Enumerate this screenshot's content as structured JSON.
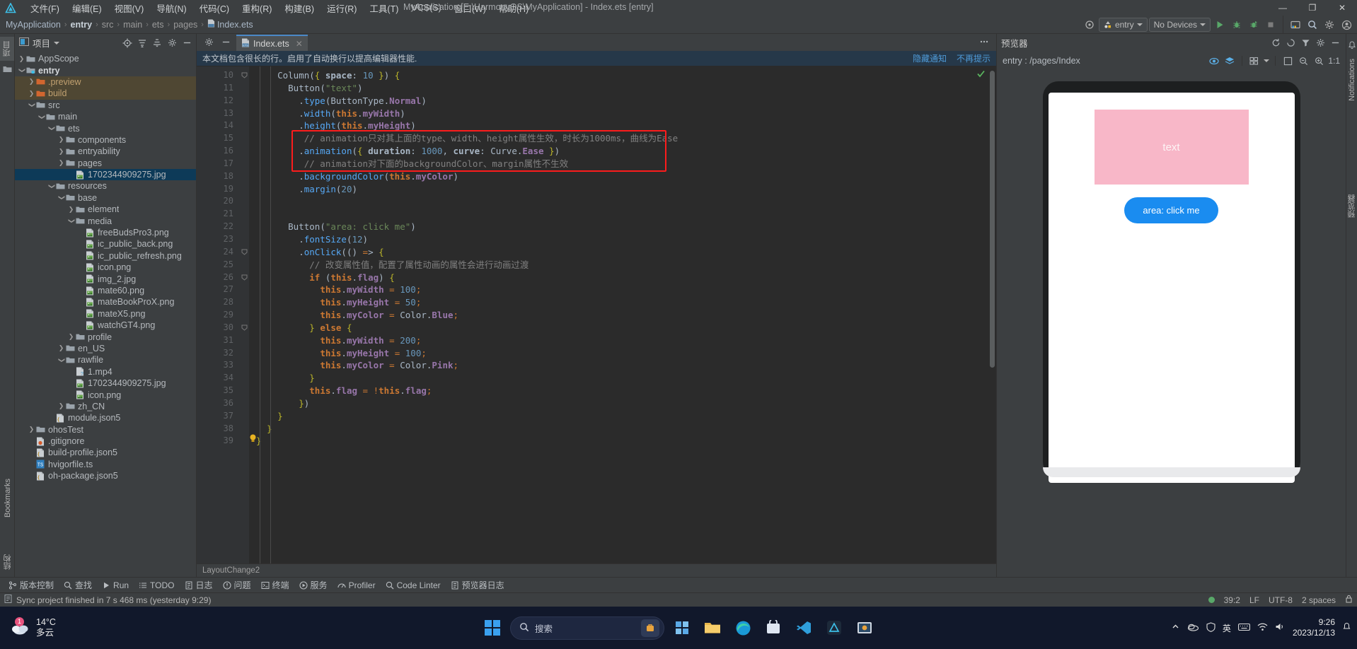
{
  "window": {
    "title": "MyApplication [E:\\HarmonyOS\\MyApplication] - Index.ets [entry]",
    "minimize": "—",
    "maximize": "❐",
    "close": "✕"
  },
  "menubar": {
    "items": [
      {
        "label": "文件(F)",
        "name": "menu-file"
      },
      {
        "label": "编辑(E)",
        "name": "menu-edit"
      },
      {
        "label": "视图(V)",
        "name": "menu-view"
      },
      {
        "label": "导航(N)",
        "name": "menu-navigate"
      },
      {
        "label": "代码(C)",
        "name": "menu-code"
      },
      {
        "label": "重构(R)",
        "name": "menu-refactor"
      },
      {
        "label": "构建(B)",
        "name": "menu-build"
      },
      {
        "label": "运行(R)",
        "name": "menu-run"
      },
      {
        "label": "工具(T)",
        "name": "menu-tools"
      },
      {
        "label": "VCS(S)",
        "name": "menu-vcs"
      },
      {
        "label": "窗口(W)",
        "name": "menu-window"
      },
      {
        "label": "帮助(H)",
        "name": "menu-help"
      }
    ]
  },
  "breadcrumb": {
    "items": [
      "MyApplication",
      "entry",
      "src",
      "main",
      "ets",
      "pages",
      "Index.ets"
    ],
    "separator": "›"
  },
  "toolbar": {
    "run_config": "entry",
    "device": "No Devices",
    "run_tooltip": "Run",
    "debug_tooltip": "Debug",
    "profile_tooltip": "Profile",
    "stop_tooltip": "Stop"
  },
  "sidebar_strip": {
    "project_tab": "项目",
    "bookmarks_tab": "Bookmarks",
    "structure_tab": "结构"
  },
  "project_panel": {
    "title": "项目",
    "tree": [
      {
        "label": "AppScope",
        "depth": 1,
        "type": "folder",
        "arrow": "collapsed",
        "state": "normal"
      },
      {
        "label": "entry",
        "depth": 1,
        "type": "module",
        "arrow": "expanded",
        "state": "bold"
      },
      {
        "label": ".preview",
        "depth": 2,
        "type": "folder-excluded",
        "arrow": "collapsed",
        "state": "highlight"
      },
      {
        "label": "build",
        "depth": 2,
        "type": "folder-excluded",
        "arrow": "collapsed",
        "state": "highlight"
      },
      {
        "label": "src",
        "depth": 2,
        "type": "folder",
        "arrow": "expanded",
        "state": "normal"
      },
      {
        "label": "main",
        "depth": 3,
        "type": "folder",
        "arrow": "expanded",
        "state": "normal"
      },
      {
        "label": "ets",
        "depth": 4,
        "type": "folder",
        "arrow": "expanded",
        "state": "normal"
      },
      {
        "label": "components",
        "depth": 5,
        "type": "folder",
        "arrow": "collapsed",
        "state": "normal"
      },
      {
        "label": "entryability",
        "depth": 5,
        "type": "folder",
        "arrow": "collapsed",
        "state": "normal"
      },
      {
        "label": "pages",
        "depth": 5,
        "type": "folder",
        "arrow": "collapsed",
        "state": "normal"
      },
      {
        "label": "1702344909275.jpg",
        "depth": 6,
        "type": "image",
        "arrow": "none",
        "state": "selected"
      },
      {
        "label": "resources",
        "depth": 4,
        "type": "folder",
        "arrow": "expanded",
        "state": "normal"
      },
      {
        "label": "base",
        "depth": 5,
        "type": "folder",
        "arrow": "expanded",
        "state": "normal"
      },
      {
        "label": "element",
        "depth": 6,
        "type": "folder",
        "arrow": "collapsed",
        "state": "normal"
      },
      {
        "label": "media",
        "depth": 6,
        "type": "folder",
        "arrow": "expanded",
        "state": "normal"
      },
      {
        "label": "freeBudsPro3.png",
        "depth": 7,
        "type": "image",
        "arrow": "none",
        "state": "normal"
      },
      {
        "label": "ic_public_back.png",
        "depth": 7,
        "type": "image",
        "arrow": "none",
        "state": "normal"
      },
      {
        "label": "ic_public_refresh.png",
        "depth": 7,
        "type": "image",
        "arrow": "none",
        "state": "normal"
      },
      {
        "label": "icon.png",
        "depth": 7,
        "type": "image",
        "arrow": "none",
        "state": "normal"
      },
      {
        "label": "img_2.jpg",
        "depth": 7,
        "type": "image",
        "arrow": "none",
        "state": "normal"
      },
      {
        "label": "mate60.png",
        "depth": 7,
        "type": "image",
        "arrow": "none",
        "state": "normal"
      },
      {
        "label": "mateBookProX.png",
        "depth": 7,
        "type": "image",
        "arrow": "none",
        "state": "normal"
      },
      {
        "label": "mateX5.png",
        "depth": 7,
        "type": "image",
        "arrow": "none",
        "state": "normal"
      },
      {
        "label": "watchGT4.png",
        "depth": 7,
        "type": "image",
        "arrow": "none",
        "state": "normal"
      },
      {
        "label": "profile",
        "depth": 6,
        "type": "folder",
        "arrow": "collapsed",
        "state": "normal"
      },
      {
        "label": "en_US",
        "depth": 5,
        "type": "folder",
        "arrow": "collapsed",
        "state": "normal"
      },
      {
        "label": "rawfile",
        "depth": 5,
        "type": "folder",
        "arrow": "expanded",
        "state": "normal"
      },
      {
        "label": "1.mp4",
        "depth": 6,
        "type": "video",
        "arrow": "none",
        "state": "normal"
      },
      {
        "label": "1702344909275.jpg",
        "depth": 6,
        "type": "image",
        "arrow": "none",
        "state": "normal"
      },
      {
        "label": "icon.png",
        "depth": 6,
        "type": "image",
        "arrow": "none",
        "state": "normal"
      },
      {
        "label": "zh_CN",
        "depth": 5,
        "type": "folder",
        "arrow": "collapsed",
        "state": "normal"
      },
      {
        "label": "module.json5",
        "depth": 4,
        "type": "json",
        "arrow": "none",
        "state": "normal"
      },
      {
        "label": "ohosTest",
        "depth": 2,
        "type": "folder",
        "arrow": "collapsed",
        "state": "normal"
      },
      {
        "label": ".gitignore",
        "depth": 2,
        "type": "gitignore",
        "arrow": "none",
        "state": "normal"
      },
      {
        "label": "build-profile.json5",
        "depth": 2,
        "type": "json",
        "arrow": "none",
        "state": "normal"
      },
      {
        "label": "hvigorfile.ts",
        "depth": 2,
        "type": "ts",
        "arrow": "none",
        "state": "normal"
      },
      {
        "label": "oh-package.json5",
        "depth": 2,
        "type": "json",
        "arrow": "none",
        "state": "normal"
      }
    ]
  },
  "editor": {
    "tab": {
      "label": "Index.ets",
      "close": "✕"
    },
    "notification": {
      "message": "本文档包含很长的行。启用了自动换行以提高编辑器性能.",
      "links": [
        "隐藏通知",
        "不再提示"
      ]
    },
    "first_line_number": 10,
    "lines": [
      {
        "n": 10,
        "text": "    Column({ space: 10 }) {",
        "fold": "expanded"
      },
      {
        "n": 11,
        "text": "      Button(\"text\")",
        "fold": "none"
      },
      {
        "n": 12,
        "text": "        .type(ButtonType.Normal)",
        "fold": "none"
      },
      {
        "n": 13,
        "text": "        .width(this.myWidth)",
        "fold": "none"
      },
      {
        "n": 14,
        "text": "        .height(this.myHeight)",
        "fold": "none"
      },
      {
        "n": 15,
        "text": "         // animation只对其上面的type、width、height属性生效，时长为1000ms，曲线为Ease",
        "fold": "none"
      },
      {
        "n": 16,
        "text": "        .animation({ duration: 1000, curve: Curve.Ease })",
        "fold": "none"
      },
      {
        "n": 17,
        "text": "         // animation对下面的backgroundColor、margin属性不生效",
        "fold": "none"
      },
      {
        "n": 18,
        "text": "        .backgroundColor(this.myColor)",
        "fold": "none"
      },
      {
        "n": 19,
        "text": "        .margin(20)",
        "fold": "none"
      },
      {
        "n": 20,
        "text": "",
        "fold": "none"
      },
      {
        "n": 21,
        "text": "",
        "fold": "none"
      },
      {
        "n": 22,
        "text": "      Button(\"area: click me\")",
        "fold": "none"
      },
      {
        "n": 23,
        "text": "        .fontSize(12)",
        "fold": "none"
      },
      {
        "n": 24,
        "text": "        .onClick(() => {",
        "fold": "expanded"
      },
      {
        "n": 25,
        "text": "          // 改变属性值，配置了属性动画的属性会进行动画过渡",
        "fold": "none"
      },
      {
        "n": 26,
        "text": "          if (this.flag) {",
        "fold": "expanded"
      },
      {
        "n": 27,
        "text": "            this.myWidth = 100;",
        "fold": "none"
      },
      {
        "n": 28,
        "text": "            this.myHeight = 50;",
        "fold": "none"
      },
      {
        "n": 29,
        "text": "            this.myColor = Color.Blue;",
        "fold": "none"
      },
      {
        "n": 30,
        "text": "          } else {",
        "fold": "expanded"
      },
      {
        "n": 31,
        "text": "            this.myWidth = 200;",
        "fold": "none"
      },
      {
        "n": 32,
        "text": "            this.myHeight = 100;",
        "fold": "none"
      },
      {
        "n": 33,
        "text": "            this.myColor = Color.Pink;",
        "fold": "none"
      },
      {
        "n": 34,
        "text": "          }",
        "fold": "none"
      },
      {
        "n": 35,
        "text": "          this.flag = !this.flag;",
        "fold": "none"
      },
      {
        "n": 36,
        "text": "        })",
        "fold": "none"
      },
      {
        "n": 37,
        "text": "    }",
        "fold": "none"
      },
      {
        "n": 38,
        "text": "  }",
        "fold": "none"
      },
      {
        "n": 39,
        "text": "}",
        "fold": "none"
      }
    ],
    "highlight_box": {
      "from_line": 15,
      "to_line": 17
    },
    "breadcrumb_bar": "LayoutChange2"
  },
  "previewer": {
    "title": "预览器",
    "path": "entry : /pages/Index",
    "zoom": "1:1",
    "device_text": "text",
    "device_button": "area: click me",
    "colors": {
      "text_button_bg": "#f8b7c8",
      "click_button_bg": "#1a8cf0"
    }
  },
  "right_strip": {
    "notifications": "Notifications",
    "previewer": "预览器"
  },
  "tool_windows": [
    {
      "label": "版本控制",
      "name": "tool-version-control",
      "icon": "branch-icon"
    },
    {
      "label": "查找",
      "name": "tool-find",
      "icon": "search-icon"
    },
    {
      "label": "Run",
      "name": "tool-run",
      "icon": "play-icon"
    },
    {
      "label": "TODO",
      "name": "tool-todo",
      "icon": "list-icon"
    },
    {
      "label": "日志",
      "name": "tool-log",
      "icon": "book-icon"
    },
    {
      "label": "问题",
      "name": "tool-problems",
      "icon": "warning-icon"
    },
    {
      "label": "终端",
      "name": "tool-terminal",
      "icon": "terminal-icon"
    },
    {
      "label": "服务",
      "name": "tool-services",
      "icon": "play-circle-icon"
    },
    {
      "label": "Profiler",
      "name": "tool-profiler",
      "icon": "gauge-icon"
    },
    {
      "label": "Code Linter",
      "name": "tool-code-linter",
      "icon": "magnifier-icon"
    },
    {
      "label": "预览器日志",
      "name": "tool-previewer-log",
      "icon": "doc-icon"
    }
  ],
  "statusbar": {
    "message": "Sync project finished in 7 s 468 ms (yesterday 9:29)",
    "caret": "39:2",
    "line_sep": "LF",
    "encoding": "UTF-8",
    "indent": "2 spaces"
  },
  "taskbar": {
    "weather_temp": "14°C",
    "weather_desc": "多云",
    "weather_badge": "1",
    "search_placeholder": "搜索",
    "clock_time": "9:26",
    "clock_date": "2023/12/13",
    "language": "英",
    "apps": [
      {
        "name": "widgets-icon"
      },
      {
        "name": "file-explorer-icon"
      },
      {
        "name": "edge-icon"
      },
      {
        "name": "store-icon"
      },
      {
        "name": "vscode-icon"
      },
      {
        "name": "deveco-icon"
      },
      {
        "name": "devtool-icon"
      }
    ]
  }
}
